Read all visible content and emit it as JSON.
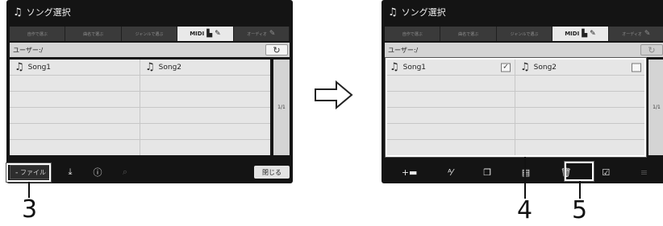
{
  "screen_title": "ソング選択",
  "tabs": [
    {
      "label": "自作で選ぶ",
      "active": false
    },
    {
      "label": "曲名で選ぶ",
      "active": false
    },
    {
      "label": "ジャンルで選ぶ",
      "active": false
    },
    {
      "label": "MIDI",
      "active": true,
      "icons": [
        "piano-icon",
        "pencil-icon"
      ]
    },
    {
      "label": "オーディオ",
      "active": false,
      "icons": [
        "pencil-icon"
      ]
    }
  ],
  "path": "ユーザー:/",
  "up_button": "↻",
  "songs": [
    {
      "name": "Song1",
      "checked_right": true
    },
    {
      "name": "Song2",
      "checked_right": false
    }
  ],
  "page_indicator": "1/1",
  "file_button": "ファイル",
  "close_button": "閉じる",
  "left_toolbar_icons": [
    "save-icon",
    "info-icon",
    "search-add-icon"
  ],
  "right_toolbar_icons": [
    "new-folder-icon",
    "rename-icon",
    "copy-icon",
    "paste-icon",
    "delete-icon",
    "select-all-icon"
  ],
  "callouts": [
    "3",
    "4",
    "5"
  ]
}
